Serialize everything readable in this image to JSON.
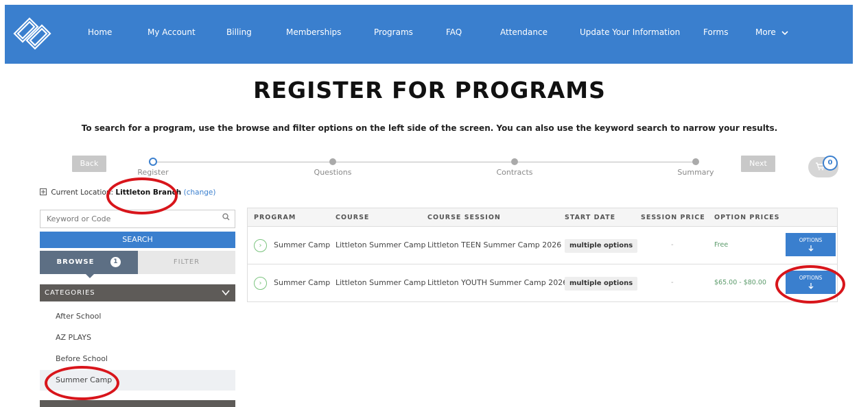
{
  "nav": {
    "items": [
      {
        "label": "Home"
      },
      {
        "label": "My Account"
      },
      {
        "label": "Billing"
      },
      {
        "label": "Memberships"
      },
      {
        "label": "Programs"
      },
      {
        "label": "FAQ"
      },
      {
        "label": "Attendance"
      },
      {
        "label": "Update Your Information"
      },
      {
        "label": "Forms"
      },
      {
        "label": "More"
      }
    ],
    "more_icon": "chevron-down-icon"
  },
  "page": {
    "title": "REGISTER FOR PROGRAMS",
    "subtitle": "To search for a program, use the browse and filter options on the left side of the screen. You can also use the keyword search to narrow your results."
  },
  "wizard": {
    "back_label": "Back",
    "next_label": "Next",
    "steps": [
      {
        "label": "Register",
        "active": true
      },
      {
        "label": "Questions",
        "active": false
      },
      {
        "label": "Contracts",
        "active": false
      },
      {
        "label": "Summary",
        "active": false
      }
    ],
    "cart_count": "0"
  },
  "location": {
    "prefix": "Current Location:",
    "name": "Littleton Branch",
    "change_label": "(change)"
  },
  "sidebar": {
    "search_placeholder": "Keyword or Code",
    "search_button": "SEARCH",
    "browse_label": "BROWSE",
    "browse_badge": "1",
    "filter_label": "FILTER",
    "categories_label": "CATEGORIES",
    "categories": [
      {
        "label": "After School"
      },
      {
        "label": "AZ PLAYS"
      },
      {
        "label": "Before School"
      },
      {
        "label": "Summer Camp"
      }
    ]
  },
  "table": {
    "headers": [
      "PROGRAM",
      "COURSE",
      "COURSE SESSION",
      "START DATE",
      "SESSION PRICE",
      "OPTION PRICES"
    ],
    "rows": [
      {
        "program": "Summer Camp",
        "course": "Littleton Summer Camp",
        "session": "Littleton TEEN Summer Camp 2026",
        "start_date": "multiple options",
        "session_price": "-",
        "option_prices": "Free",
        "button": "OPTIONS"
      },
      {
        "program": "Summer Camp",
        "course": "Littleton Summer Camp",
        "session": "Littleton YOUTH Summer Camp 2026",
        "start_date": "multiple options",
        "session_price": "-",
        "option_prices": "$65.00 - $80.00",
        "button": "OPTIONS"
      }
    ]
  },
  "colors": {
    "nav_bg": "#3a7fce",
    "annotation": "#d8151b"
  }
}
